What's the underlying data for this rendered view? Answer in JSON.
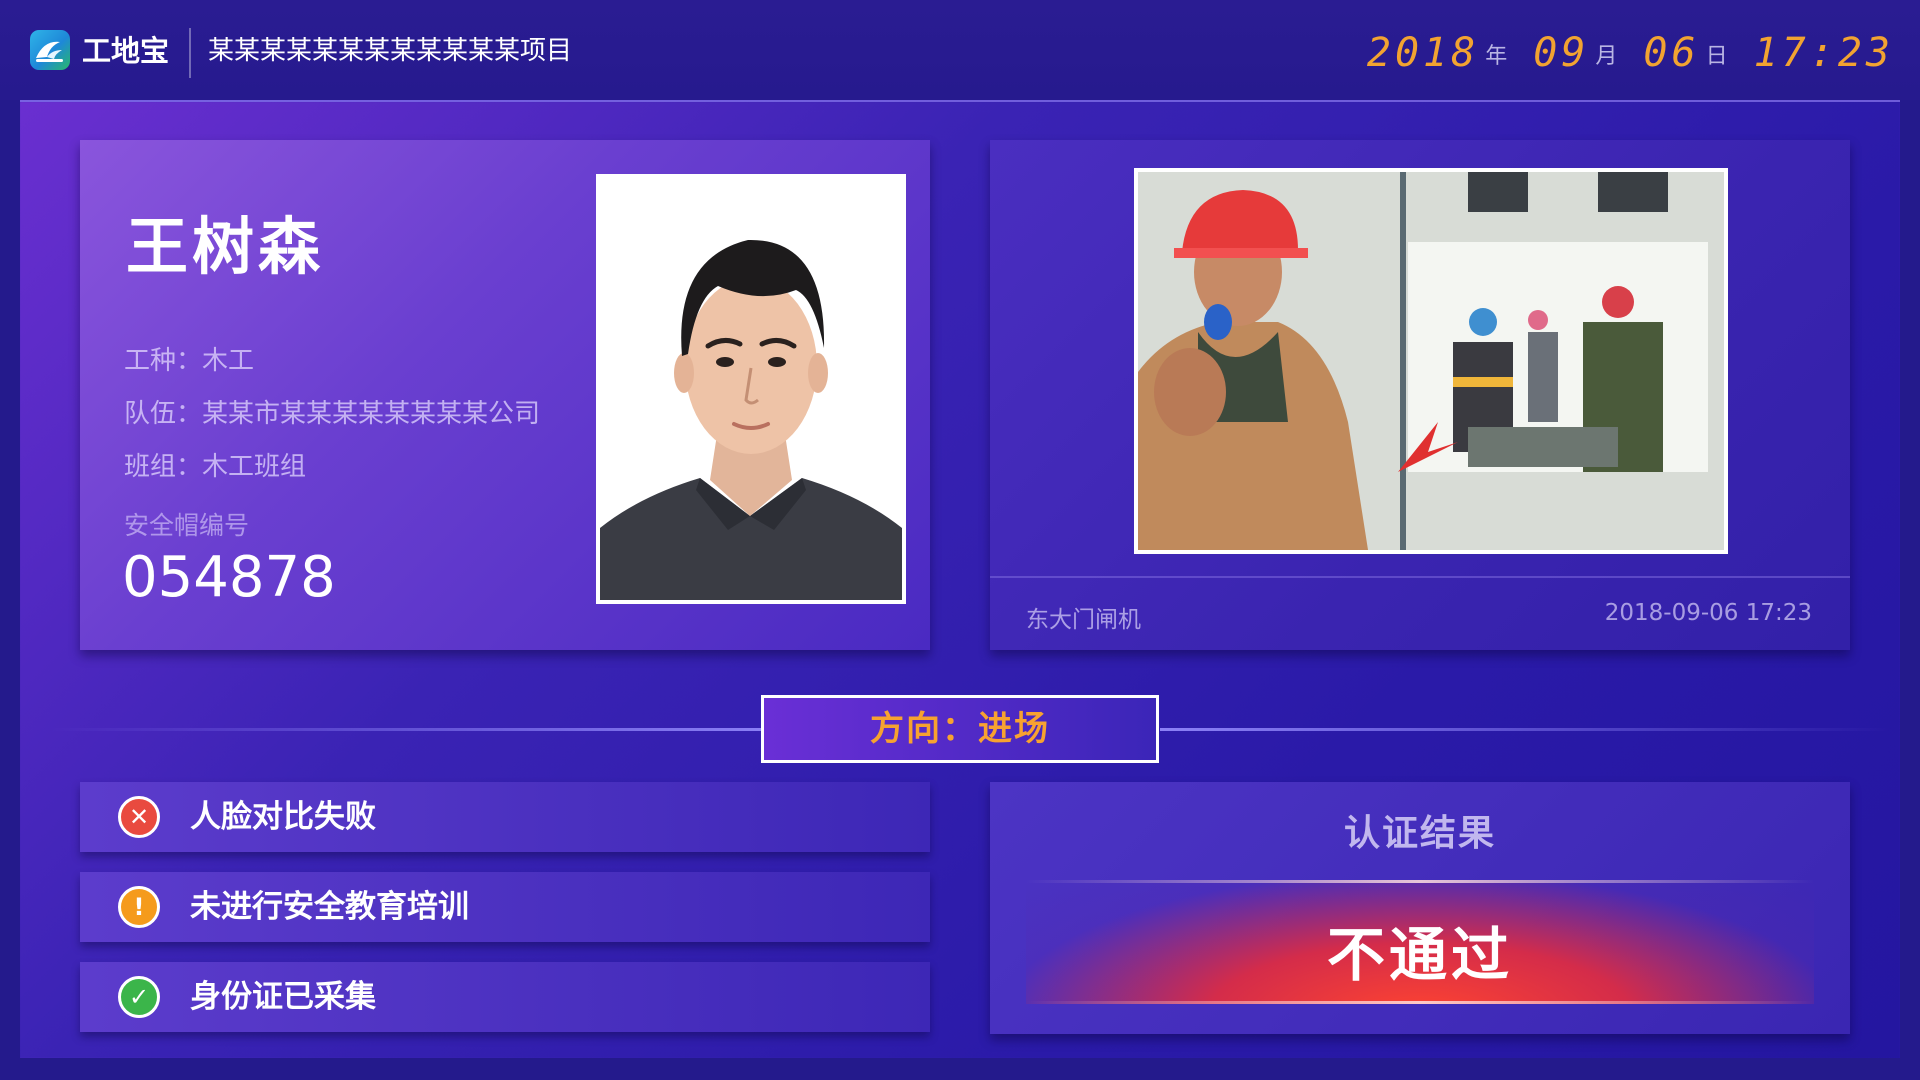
{
  "header": {
    "app_name": "工地宝",
    "project_name": "某某某某某某某某某某某某项目",
    "datetime": {
      "year": "2018",
      "year_unit": "年",
      "month": "09",
      "month_unit": "月",
      "day": "06",
      "day_unit": "日",
      "time": "17:23"
    }
  },
  "worker": {
    "name": "王树森",
    "trade_label": "工种：",
    "trade": "木工",
    "team_label": "队伍：",
    "team": "某某市某某某某某某某某公司",
    "group_label": "班组：",
    "group": "木工班组",
    "helmet_label": "安全帽编号",
    "helmet_number": "054878"
  },
  "capture": {
    "gate": "东大门闸机",
    "time": "2018-09-06 17:23"
  },
  "direction": {
    "text": "方向：进场"
  },
  "checks": [
    {
      "label": "人脸对比失败",
      "status": "fail",
      "color": "#e94a3f",
      "icon": "close-icon",
      "glyph": "✕"
    },
    {
      "label": "未进行安全教育培训",
      "status": "warning",
      "color": "#f59b1c",
      "icon": "exclamation-icon",
      "glyph": "!"
    },
    {
      "label": "身份证已采集",
      "status": "pass",
      "color": "#3bb54a",
      "icon": "check-icon",
      "glyph": "✓"
    }
  ],
  "result": {
    "title": "认证结果",
    "value": "不通过"
  },
  "colors": {
    "accent_orange": "#f2a331",
    "background": "#241a8c",
    "fail_red": "#e94a3f"
  }
}
